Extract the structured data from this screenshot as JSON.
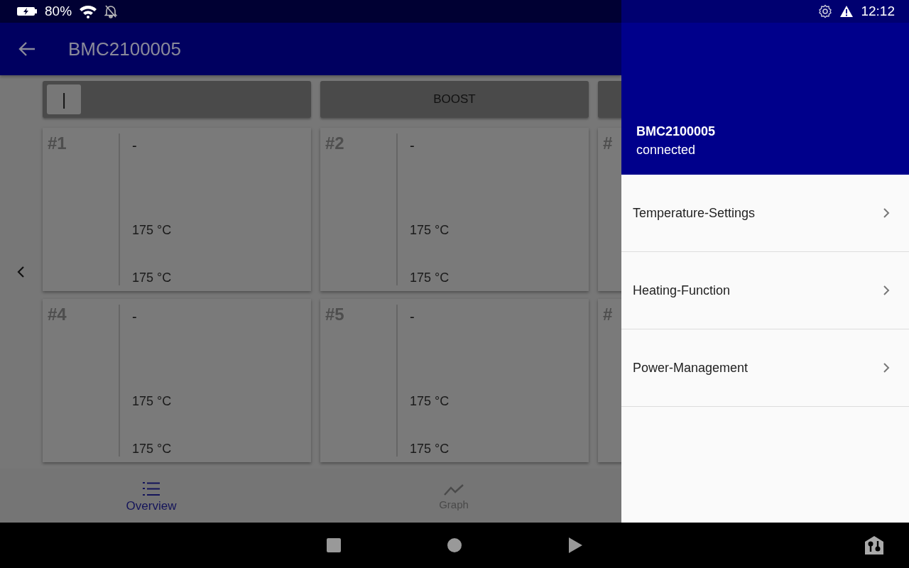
{
  "status_bar": {
    "battery": "80%",
    "time": "12:12"
  },
  "app_bar": {
    "title": "BMC2100005"
  },
  "mode_buttons": [
    {
      "kind": "switch",
      "on": false,
      "thumb_label": "|"
    },
    {
      "kind": "button",
      "label": "BOOST"
    },
    {
      "kind": "button"
    }
  ],
  "zones": [
    {
      "number": "#1",
      "value": "-",
      "setpoint": "175 °C",
      "actual": "175 °C"
    },
    {
      "number": "#2",
      "value": "-",
      "setpoint": "175 °C",
      "actual": "175 °C"
    },
    {
      "number": "#"
    },
    {
      "number": "#4",
      "value": "-",
      "setpoint": "175 °C",
      "actual": "175 °C"
    },
    {
      "number": "#5",
      "value": "-",
      "setpoint": "175 °C",
      "actual": "175 °C"
    },
    {
      "number": "#"
    }
  ],
  "bottom_nav": [
    {
      "label": "Overview",
      "selected": true
    },
    {
      "label": "Graph",
      "selected": false
    }
  ],
  "drawer": {
    "device": "BMC2100005",
    "status": "connected",
    "items": [
      "Temperature-Settings",
      "Heating-Function",
      "Power-Management"
    ]
  }
}
